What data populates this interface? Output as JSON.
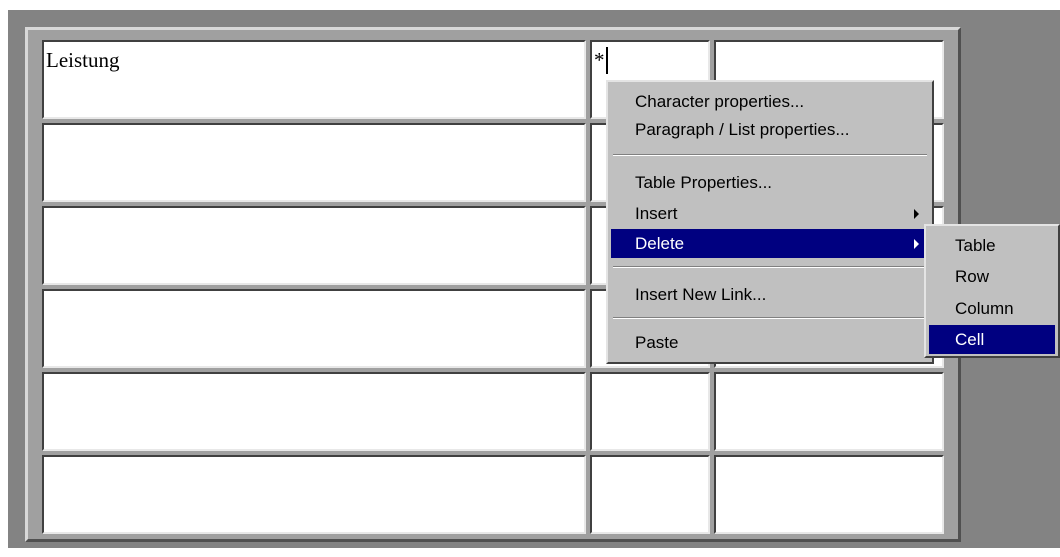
{
  "table": {
    "rows": [
      [
        "Leistung",
        "*",
        ""
      ],
      [
        "",
        "",
        ""
      ],
      [
        "",
        "",
        ""
      ],
      [
        "",
        "",
        ""
      ],
      [
        "",
        "",
        ""
      ],
      [
        "",
        "",
        ""
      ]
    ]
  },
  "context_menu": {
    "items": [
      {
        "label": "Character properties..."
      },
      {
        "label": "Paragraph / List properties..."
      },
      {
        "label": "Table Properties..."
      },
      {
        "label": "Insert",
        "has_submenu": true
      },
      {
        "label": "Delete",
        "has_submenu": true,
        "active": true
      },
      {
        "label": "Insert New Link..."
      },
      {
        "label": "Paste"
      }
    ]
  },
  "delete_submenu": {
    "items": [
      {
        "label": "Table"
      },
      {
        "label": "Row"
      },
      {
        "label": "Column"
      },
      {
        "label": "Cell",
        "active": true
      }
    ]
  },
  "colors": {
    "highlight": "#000080",
    "menu_bg": "#c0c0c0",
    "frame_bg": "#838383"
  }
}
